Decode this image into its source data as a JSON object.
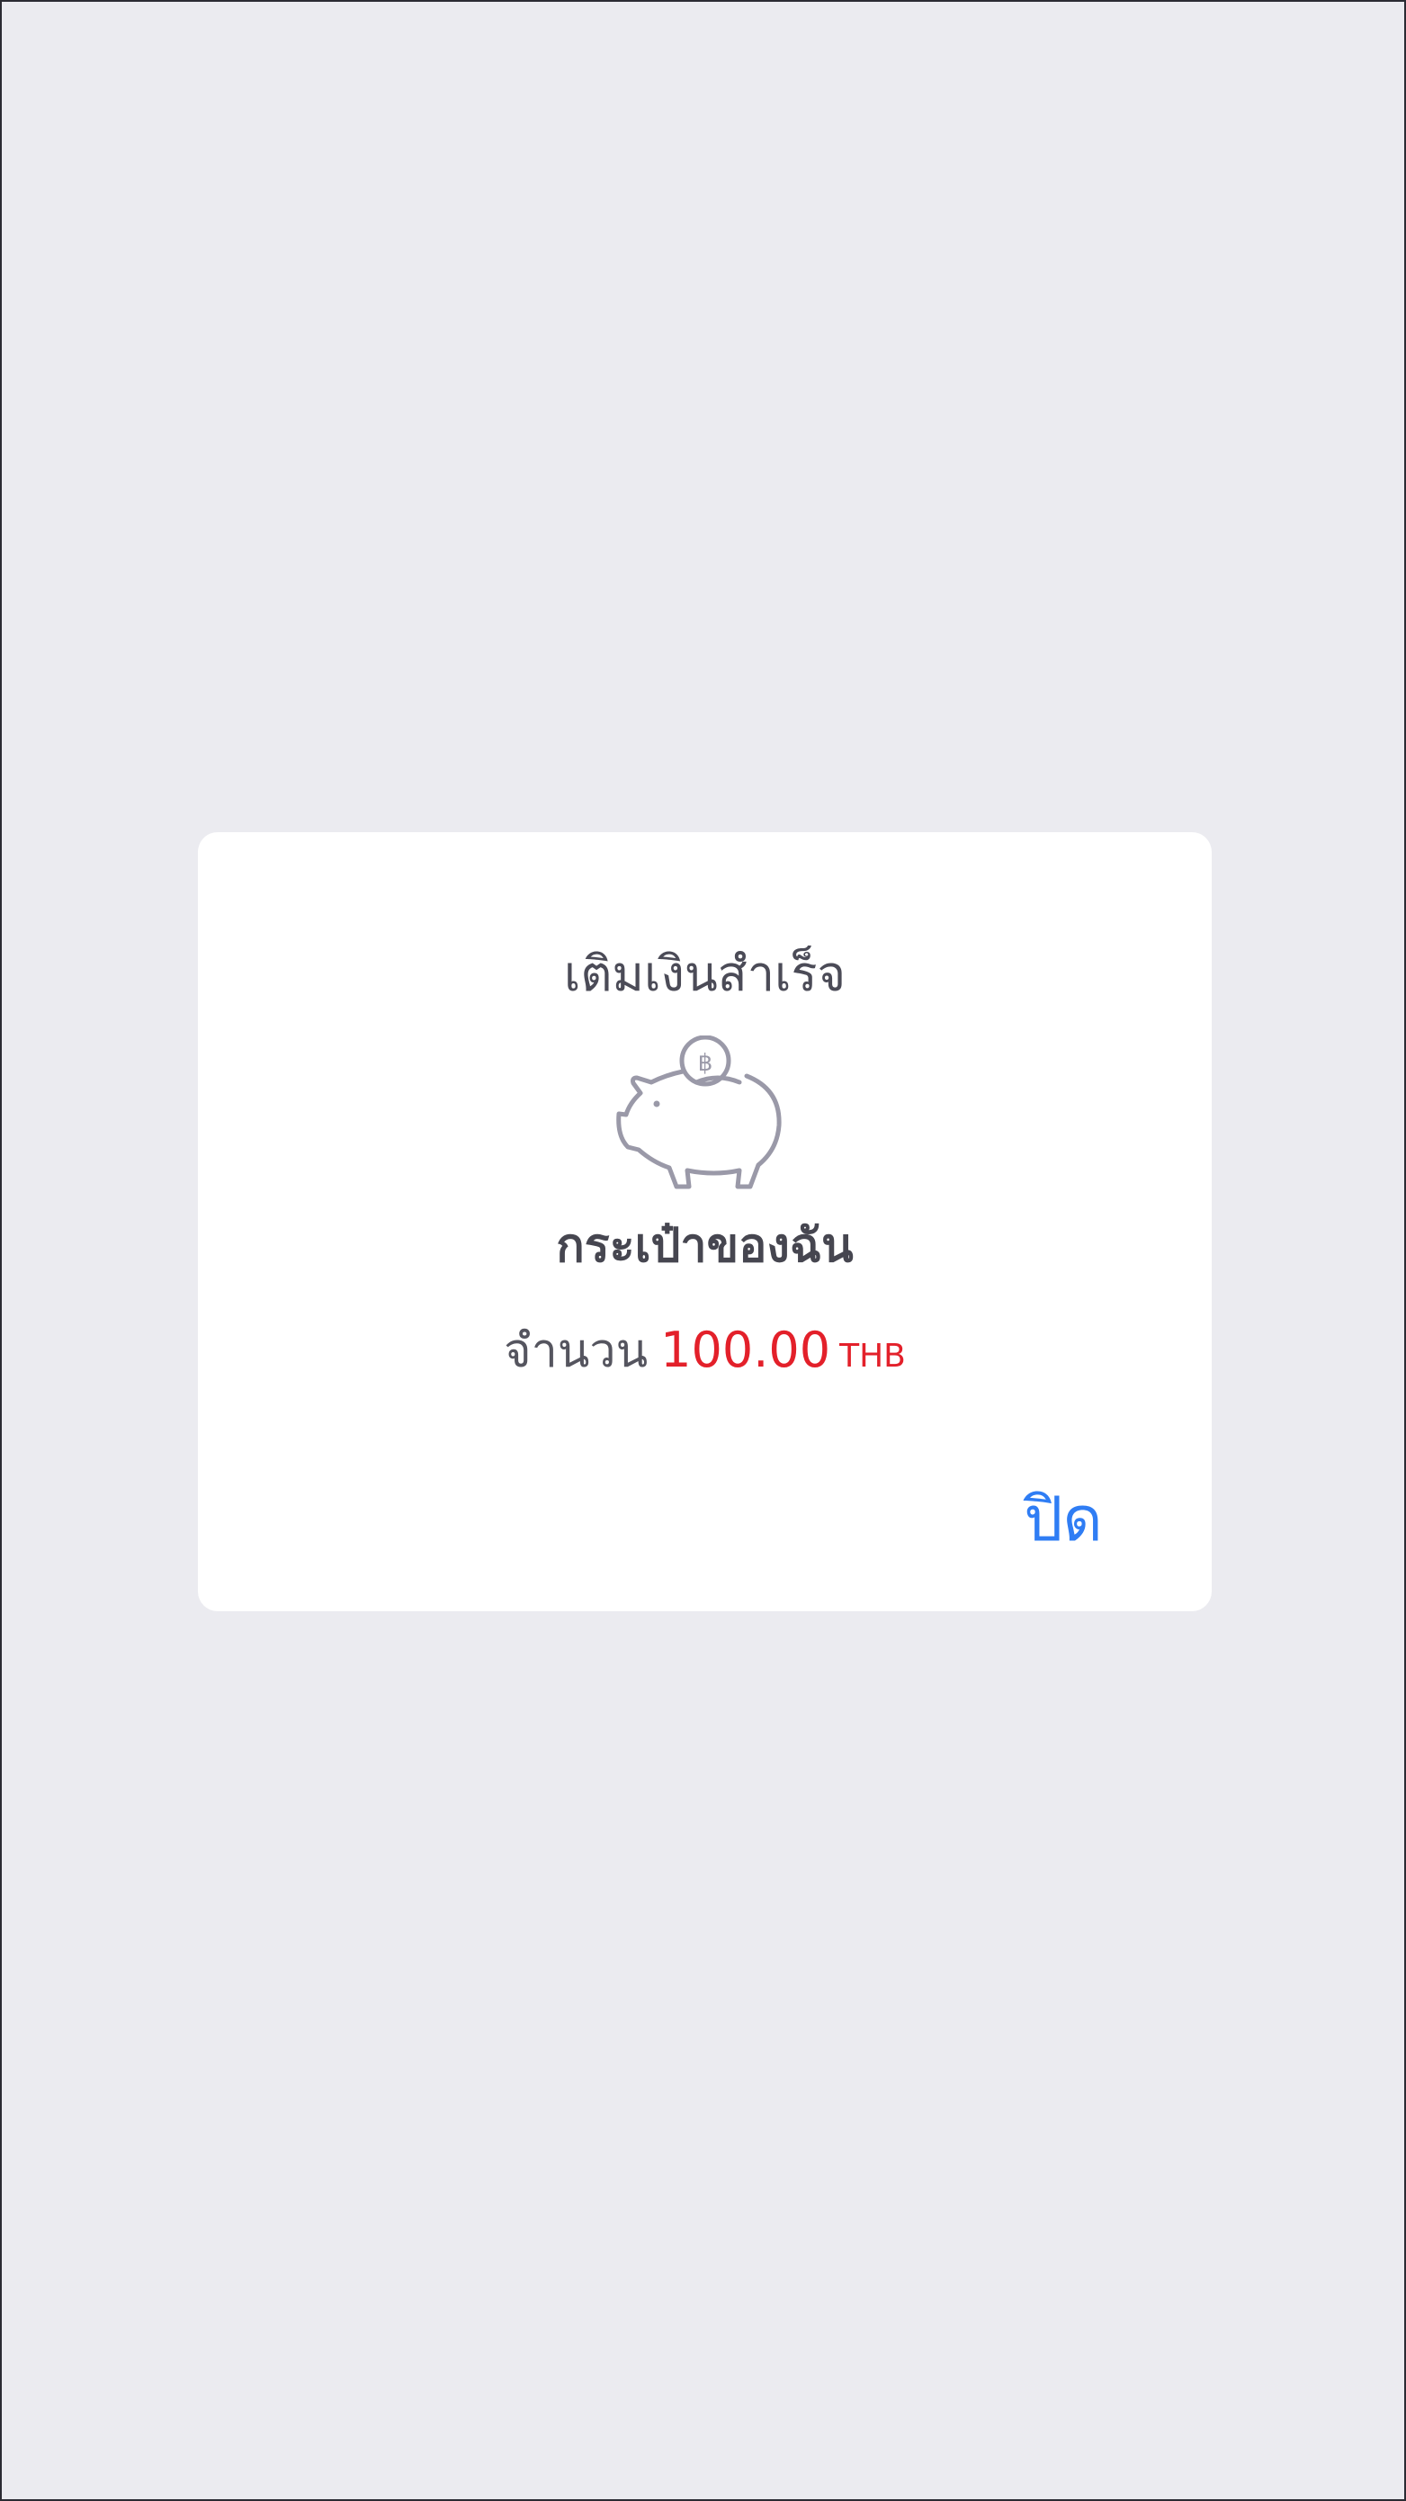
{
  "dialog": {
    "title": "เติมเงินสำเร็จ",
    "icon": "piggy-bank-baht-icon",
    "wallet_name": "กระเป๋าของฉัน",
    "amount_label": "จำนวน",
    "amount_value": "100.00",
    "currency": "THB",
    "close_label": "ปิด"
  },
  "colors": {
    "background": "#ebebf0",
    "card": "#ffffff",
    "amount": "#e3202a",
    "action": "#2f7df4",
    "icon": "#9a99a8"
  }
}
